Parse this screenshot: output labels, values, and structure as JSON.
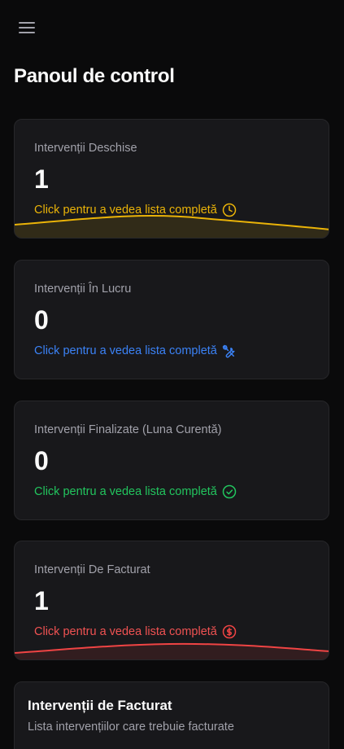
{
  "header": {
    "menu_icon": "hamburger-menu-icon",
    "title": "Panoul de control"
  },
  "cards": [
    {
      "title": "Intervenții Deschise",
      "value": "1",
      "link": "Click pentru a vedea lista completă",
      "icon": "clock-icon",
      "accent": "#eab308"
    },
    {
      "title": "Intervenții În Lucru",
      "value": "0",
      "link": "Click pentru a vedea lista completă",
      "icon": "tools-icon",
      "accent": "#3b82f6"
    },
    {
      "title": "Intervenții Finalizate (Luna Curentă)",
      "value": "0",
      "link": "Click pentru a vedea lista completă",
      "icon": "check-circle-icon",
      "accent": "#22c55e"
    },
    {
      "title": "Intervenții De Facturat",
      "value": "1",
      "link": "Click pentru a vedea lista completă",
      "icon": "dollar-circle-icon",
      "accent": "#ef4444"
    }
  ],
  "invoice_section": {
    "title": "Intervenții de Facturat",
    "subtitle": "Lista intervențiilor care trebuie facturate"
  },
  "colors": {
    "background": "#0a0a0b",
    "card": "#18181b",
    "border": "#27272a",
    "muted_text": "#a1a1aa"
  }
}
